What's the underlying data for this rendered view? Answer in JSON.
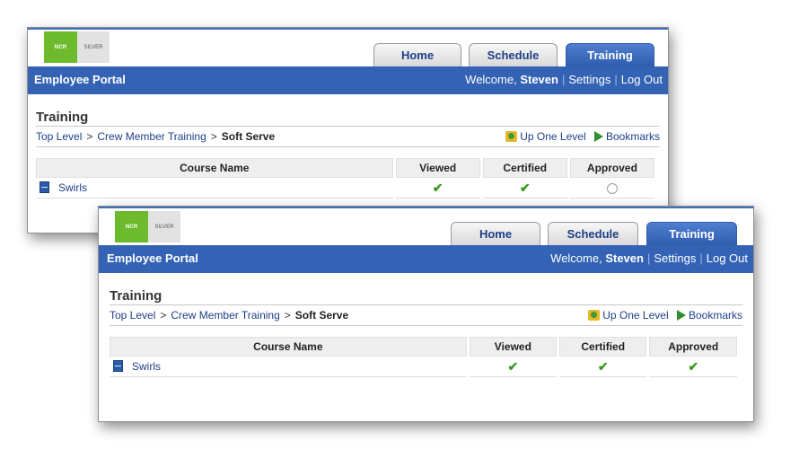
{
  "windows": [
    {
      "logo": {
        "ncr": "NCR",
        "silver": "SILVER"
      },
      "tabs": [
        "Home",
        "Schedule",
        "Training"
      ],
      "active_tab": "Training",
      "portal_title": "Employee Portal",
      "welcome_prefix": "Welcome, ",
      "user_name": "Steven",
      "settings": "Settings",
      "logout": "Log Out",
      "page_title": "Training",
      "breadcrumb": [
        "Top Level",
        "Crew Member Training",
        "Soft Serve"
      ],
      "up_one_level": "Up One Level",
      "bookmarks": "Bookmarks",
      "columns": [
        "Course Name",
        "Viewed",
        "Certified",
        "Approved"
      ],
      "rows": [
        {
          "name": "Swirls",
          "viewed": true,
          "certified": true,
          "approved": false
        }
      ]
    },
    {
      "logo": {
        "ncr": "NCR",
        "silver": "SILVER"
      },
      "tabs": [
        "Home",
        "Schedule",
        "Training"
      ],
      "active_tab": "Training",
      "portal_title": "Employee Portal",
      "welcome_prefix": "Welcome, ",
      "user_name": "Steven",
      "settings": "Settings",
      "logout": "Log Out",
      "page_title": "Training",
      "breadcrumb": [
        "Top Level",
        "Crew Member Training",
        "Soft Serve"
      ],
      "up_one_level": "Up One Level",
      "bookmarks": "Bookmarks",
      "columns": [
        "Course Name",
        "Viewed",
        "Certified",
        "Approved"
      ],
      "rows": [
        {
          "name": "Swirls",
          "viewed": true,
          "certified": true,
          "approved": true
        }
      ]
    }
  ],
  "colors": {
    "accent": "#3463b5",
    "logo_green": "#6dbb2c",
    "check_green": "#3a9a22"
  },
  "icons": {
    "up_level": "up-level-icon",
    "bookmarks": "bookmark-icon",
    "course": "course-file-icon",
    "check": "check-icon",
    "empty": "empty-circle-icon"
  }
}
